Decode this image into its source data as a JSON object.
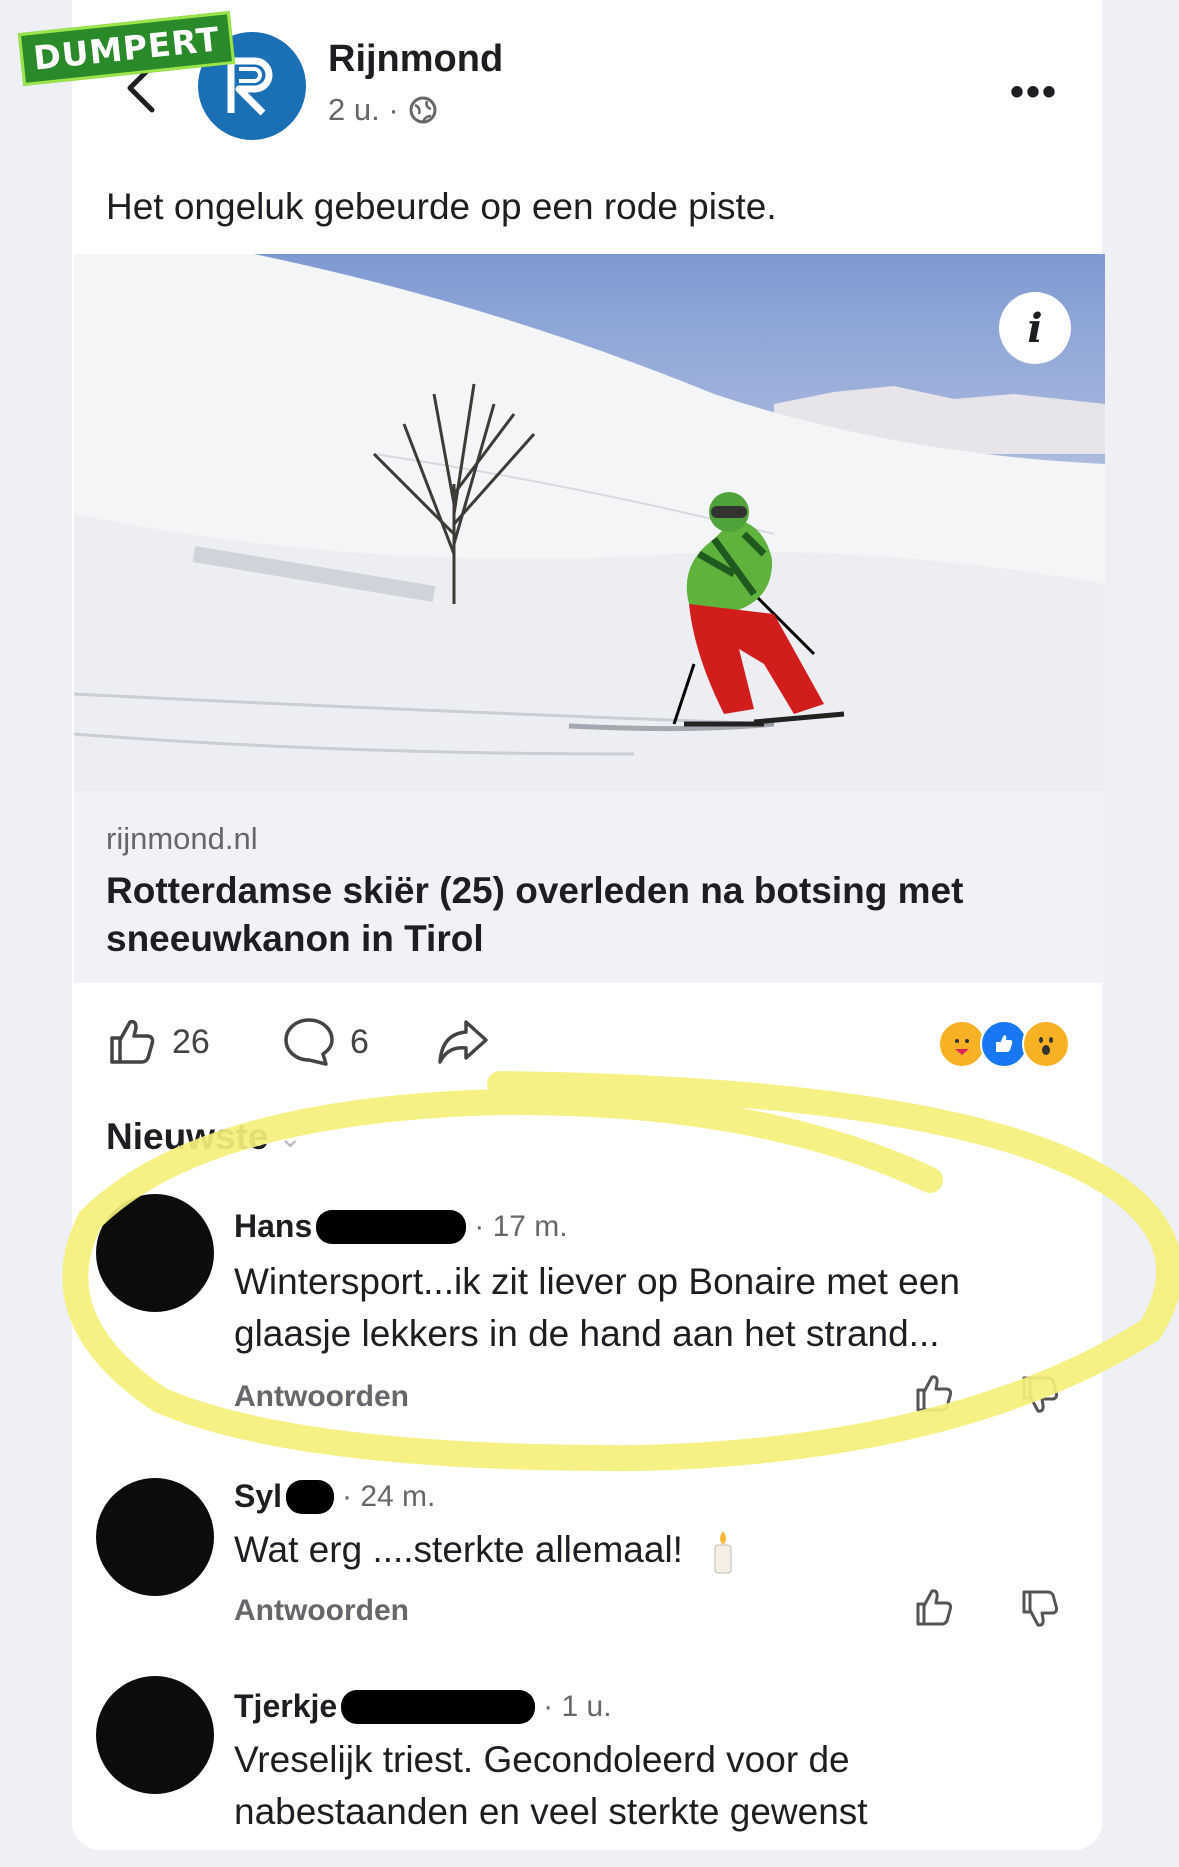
{
  "watermark": "DUMPERT",
  "post": {
    "page_name": "Rijnmond",
    "time": "2 u. ·",
    "text": "Het ongeluk gebeurde op een rode piste.",
    "link_domain": "rijnmond.nl",
    "link_title": "Rotterdamse skiër (25) overleden na botsing met sneeuwkanon in Tirol",
    "likes": "26",
    "comments": "6",
    "sort_label": "Nieuwste"
  },
  "comments": [
    {
      "name": "Hans",
      "time": "· 17 m.",
      "text": "Wintersport...ik zit liever op Bonaire met een glaasje lekkers in de hand aan het strand...",
      "reply": "Antwoorden"
    },
    {
      "name": "Syl",
      "time": "· 24 m.",
      "text": "Wat erg ....sterkte allemaal!",
      "reply": "Antwoorden"
    },
    {
      "name": "Tjerkje",
      "time": "· 1 u.",
      "text": "Vreselijk triest. Gecondoleerd voor de nabestaanden en veel sterkte gewenst"
    }
  ],
  "colors": {
    "highlight": "#f5f07a",
    "brand": "#1a6fb5"
  }
}
